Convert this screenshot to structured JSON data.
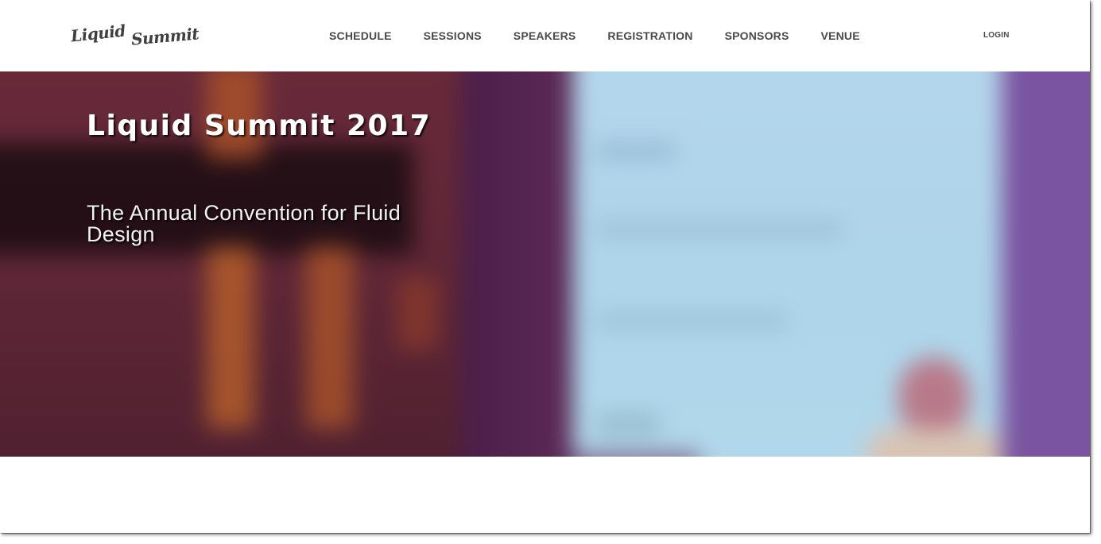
{
  "header": {
    "logo_word_1": "Liquid",
    "logo_word_2": "Summit",
    "nav": [
      {
        "label": "SCHEDULE"
      },
      {
        "label": "SESSIONS"
      },
      {
        "label": "SPEAKERS"
      },
      {
        "label": "REGISTRATION"
      },
      {
        "label": "SPONSORS"
      },
      {
        "label": "VENUE"
      }
    ],
    "login_label": "LOGIN"
  },
  "hero": {
    "title": "Liquid Summit 2017",
    "subtitle": "The Annual Convention for Fluid Design"
  },
  "colors": {
    "nav_text": "#4a4a4a",
    "hero_text": "#ffffff",
    "hero_dark": "#5e2636",
    "hero_screen": "#b4d6ec",
    "hero_right": "#7a54a0"
  }
}
